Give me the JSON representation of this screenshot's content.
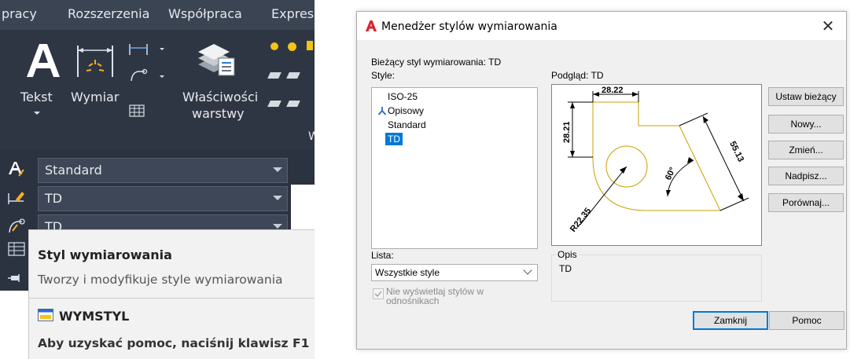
{
  "ribbon": {
    "tabs": [
      "pracy",
      "Rozszerzenia",
      "Współpraca",
      "Express"
    ],
    "buttons": {
      "text_label": "Tekst",
      "dim_label": "Wymiar",
      "layer_props_line1": "Właściwości",
      "layer_props_line2": "warstwy",
      "panel_letter": "W"
    },
    "combos": [
      {
        "name": "text-style",
        "value": "Standard"
      },
      {
        "name": "dim-style",
        "value": "TD"
      },
      {
        "name": "mleader-style",
        "value": "TD"
      }
    ]
  },
  "tooltip": {
    "title": "Styl wymiarowania",
    "description": "Tworzy i modyfikuje style wymiarowania",
    "command": "WYMSTYL",
    "help": "Aby uzyskać pomoc, naciśnij klawisz F1"
  },
  "dialog": {
    "title": "Menedżer stylów wymiarowania",
    "current_style_label": "Bieżący styl wymiarowania: TD",
    "styles_label": "Style:",
    "styles": [
      "ISO-25",
      "Opisowy",
      "Standard",
      "TD"
    ],
    "selected_style": "TD",
    "preview_label": "Podgląd: TD",
    "preview_dims": [
      "28.22",
      "28.21",
      "55.13",
      "60°",
      "R22.35"
    ],
    "list_label": "Lista:",
    "list_value": "Wszystkie style",
    "checkbox_label": "Nie wyświetlaj stylów w odnośnikach",
    "checkbox_checked": true,
    "description_title": "Opis",
    "description_value": "TD",
    "buttons": {
      "set_current": "Ustaw bieżący",
      "new": "Nowy...",
      "modify": "Zmień...",
      "override": "Nadpisz...",
      "compare": "Porównaj...",
      "close": "Zamknij",
      "help": "Pomoc"
    }
  },
  "colors": {
    "accent": "#0078d7",
    "ribbon_bg": "#2f3643",
    "preview_geometry": "#c8a000",
    "app_icon": "#d9232a"
  }
}
